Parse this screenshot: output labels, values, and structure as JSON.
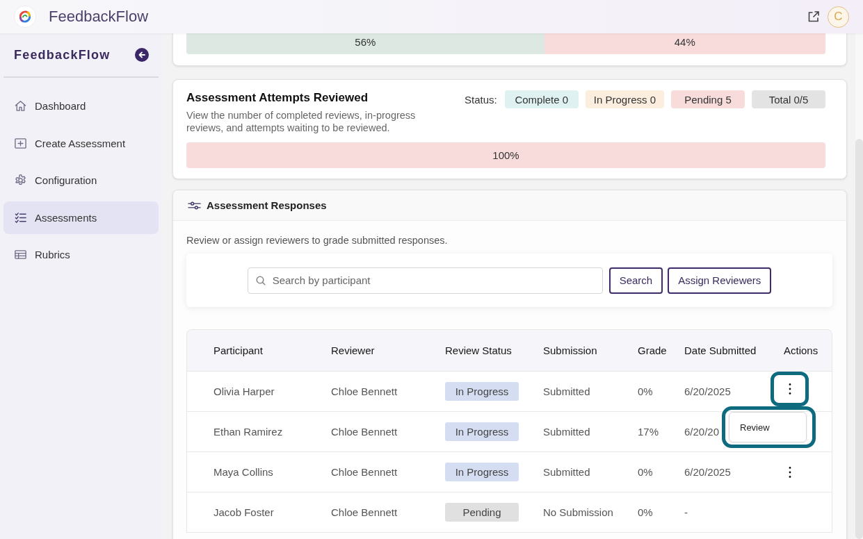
{
  "top_bar": {
    "app_name": "FeedbackFlow",
    "avatar_initial": "C"
  },
  "sidebar": {
    "title": "FeedbackFlow",
    "items": [
      {
        "label": "Dashboard",
        "selected": false
      },
      {
        "label": "Create Assessment",
        "selected": false
      },
      {
        "label": "Configuration",
        "selected": false
      },
      {
        "label": "Assessments",
        "selected": true
      },
      {
        "label": "Rubrics",
        "selected": false
      }
    ]
  },
  "score_card": {
    "bar": [
      {
        "label": "56%",
        "level": 0.56,
        "color": "#dce8e1"
      },
      {
        "label": "44%",
        "level": 0.44,
        "color": "#f8dbdb"
      }
    ]
  },
  "attempts_card": {
    "title": "Assessment Attempts Reviewed",
    "description": "View the number of completed reviews, in-progress reviews, and attempts waiting to be reviewed.",
    "status_label": "Status:",
    "badges": [
      {
        "label": "Complete 0",
        "color": "#dff1f1"
      },
      {
        "label": "In Progress 0",
        "color": "#fbeedf"
      },
      {
        "label": "Pending 5",
        "color": "#f8dbdb"
      },
      {
        "label": "Total 0/5",
        "color": "#e3e3e3"
      }
    ],
    "bar": [
      {
        "label": "100%",
        "level": 1,
        "color": "#f8dbdb"
      }
    ]
  },
  "responses_card": {
    "title": "Assessment Responses",
    "description": "Review or assign reviewers to grade submitted responses.",
    "search": {
      "placeholder": "Search by participant"
    },
    "buttons": [
      "Search",
      "Assign Reviewers"
    ],
    "table": {
      "columns": [
        "Participant",
        "Reviewer",
        "Review Status",
        "Submission",
        "Grade",
        "Date Submitted",
        "Actions"
      ],
      "rows": [
        {
          "participant": "Olivia Harper",
          "reviewer": "Chloe Bennett",
          "review_status": {
            "label": "In Progress",
            "kind": "in_progress"
          },
          "submission": "Submitted",
          "grade": "0%",
          "date_submitted": "6/20/2025",
          "actions": {
            "highlighted": true,
            "menu_open": true
          }
        },
        {
          "participant": "Ethan Ramirez",
          "reviewer": "Chloe Bennett",
          "review_status": {
            "label": "In Progress",
            "kind": "in_progress"
          },
          "submission": "Submitted",
          "grade": "17%",
          "date_submitted": "6/20/20"
        },
        {
          "participant": "Maya Collins",
          "reviewer": "Chloe Bennett",
          "review_status": {
            "label": "In Progress",
            "kind": "in_progress"
          },
          "submission": "Submitted",
          "grade": "0%",
          "date_submitted": "6/20/2025",
          "actions": {
            "highlighted": false,
            "menu_open": false
          }
        },
        {
          "participant": "Jacob Foster",
          "reviewer": "Chloe Bennett",
          "review_status": {
            "label": "Pending",
            "kind": "pending"
          },
          "submission": "No Submission",
          "grade": "0%",
          "date_submitted": "-"
        }
      ],
      "row_menu": {
        "highlighted": true,
        "items": [
          {
            "label": "Review"
          }
        ]
      }
    }
  }
}
